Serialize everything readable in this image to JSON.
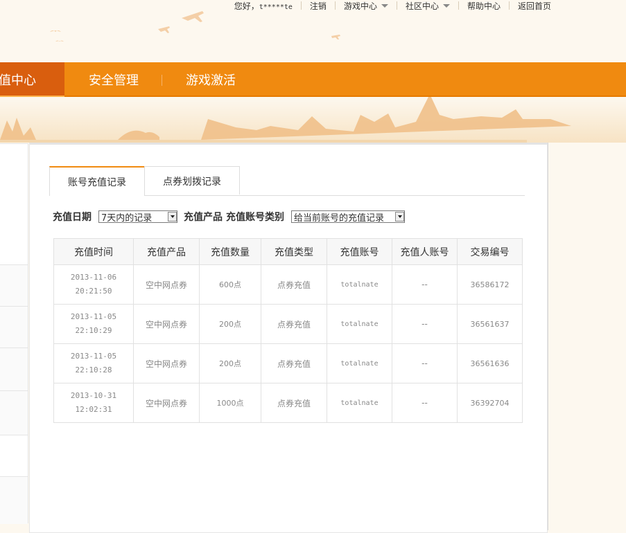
{
  "topbar": {
    "greeting": "您好，",
    "username": "t*****te",
    "logout": "注销",
    "game_center": "游戏中心",
    "community": "社区中心",
    "help": "帮助中心",
    "home": "返回首页"
  },
  "nav": {
    "active": "充值中心",
    "items": [
      "安全管理",
      "游戏激活"
    ]
  },
  "tabs": [
    "账号充值记录",
    "点券划拨记录"
  ],
  "filter": {
    "date_label": "充值日期",
    "date_value": "7天内的记录",
    "product_label": "充值产品",
    "account_type_label": "充值账号类别",
    "account_type_value": "给当前账号的充值记录"
  },
  "table": {
    "headers": [
      "充值时间",
      "充值产品",
      "充值数量",
      "充值类型",
      "充值账号",
      "充值人账号",
      "交易编号"
    ],
    "rows": [
      {
        "date": "2013-11-06",
        "time": "20:21:50",
        "product": "空中网点券",
        "amount": "600点",
        "type": "点券充值",
        "account": "totalnate",
        "payer": "--",
        "txn": "36586172"
      },
      {
        "date": "2013-11-05",
        "time": "22:10:29",
        "product": "空中网点券",
        "amount": "200点",
        "type": "点券充值",
        "account": "totalnate",
        "payer": "--",
        "txn": "36561637"
      },
      {
        "date": "2013-11-05",
        "time": "22:10:28",
        "product": "空中网点券",
        "amount": "200点",
        "type": "点券充值",
        "account": "totalnate",
        "payer": "--",
        "txn": "36561636"
      },
      {
        "date": "2013-10-31",
        "time": "12:02:31",
        "product": "空中网点券",
        "amount": "1000点",
        "type": "点券充值",
        "account": "totalnate",
        "payer": "--",
        "txn": "36392704"
      }
    ]
  },
  "colors": {
    "nav_bg": "#f08a10",
    "nav_active_bg": "#d95e0e",
    "page_bg": "#fdf8ef"
  }
}
